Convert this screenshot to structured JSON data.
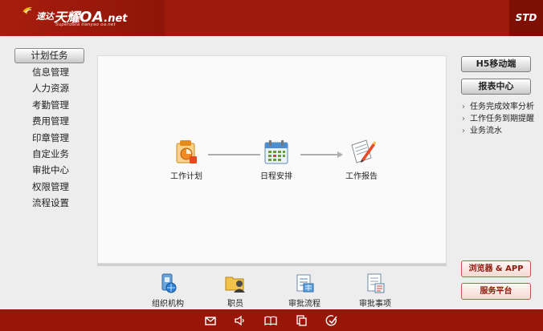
{
  "header": {
    "logo_a": "速达",
    "logo_b": "天耀",
    "logo_c": "OA",
    "logo_d": ".net",
    "logo_sub": "Superdata tianyao oa.net",
    "edition": "STD"
  },
  "sidebar": {
    "active": "计划任务",
    "items": [
      "信息管理",
      "人力资源",
      "考勤管理",
      "费用管理",
      "印章管理",
      "自定业务",
      "审批中心",
      "权限管理",
      "流程设置"
    ]
  },
  "flow": {
    "nodes": [
      {
        "label": "工作计划",
        "icon": "work-plan-icon"
      },
      {
        "label": "日程安排",
        "icon": "calendar-icon"
      },
      {
        "label": "工作报告",
        "icon": "work-report-icon"
      }
    ]
  },
  "quick": {
    "items": [
      {
        "label": "组织机构",
        "icon": "org-structure-icon"
      },
      {
        "label": "职员",
        "icon": "staff-icon"
      },
      {
        "label": "审批流程",
        "icon": "approval-flow-icon"
      },
      {
        "label": "审批事项",
        "icon": "approval-items-icon"
      }
    ]
  },
  "right": {
    "h5_button": "H5移动端",
    "report_button": "报表中心",
    "links": [
      "任务完成效率分析",
      "工作任务到期提醒",
      "业务流水"
    ],
    "browser_button": "浏览器 & APP",
    "service_button": "服务平台"
  },
  "footer": {
    "icons": [
      "mail-icon",
      "speaker-icon",
      "book-icon",
      "copy-icon",
      "check-circle-icon"
    ]
  },
  "colors": {
    "brand_red": "#9e1a0c",
    "footer_red": "#971608",
    "accent_red_text": "#8d1a0d"
  }
}
